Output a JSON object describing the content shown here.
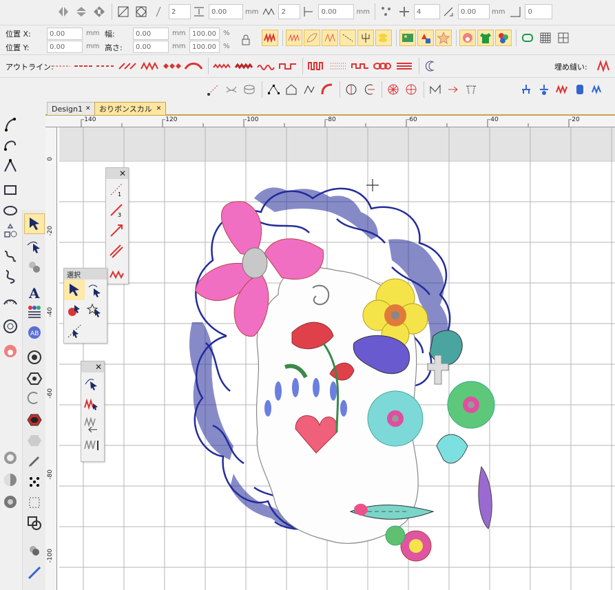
{
  "toolbar1": {
    "f1_value": "2",
    "f1_unit": "",
    "f2_value": "0.00",
    "f2_unit": "mm",
    "f3_value": "2",
    "f3_unit": "",
    "f4_value": "0.00",
    "f4_unit": "mm",
    "f5_value": "4",
    "f5_unit": "",
    "f6_value": "0.00",
    "f6_unit": "mm",
    "f7_value": "0",
    "f7_unit": ""
  },
  "position": {
    "x_label": "位置 X:",
    "y_label": "位置 Y:",
    "x_value": "0.00",
    "y_value": "0.00",
    "unit": "mm",
    "width_label": "幅:",
    "height_label": "高さ:",
    "width_value": "0.00",
    "height_value": "0.00",
    "width_pct": "100.00",
    "height_pct": "100.00",
    "pct_unit": "%"
  },
  "outline": {
    "label": "アウトライン:",
    "fill_label": "埋め縫い:"
  },
  "tabs": [
    {
      "label": "Design1",
      "close": "✕"
    },
    {
      "label": "おりボンスカル",
      "close": "✕"
    }
  ],
  "ruler": {
    "top_labels": [
      "-140",
      "-120",
      "-100",
      "-80",
      "-60",
      "-40",
      "-20"
    ],
    "left_labels": [
      "0",
      "-20",
      "-40",
      "-60",
      "-80",
      "-100"
    ]
  },
  "panels": {
    "select_title": "選択",
    "close": "✕"
  },
  "colors": {
    "accent_selected": "#fde9a8",
    "embroidery_blue": "#232c9a",
    "bow_pink": "#f06fc2",
    "yellow_flower": "#f5e34a"
  }
}
